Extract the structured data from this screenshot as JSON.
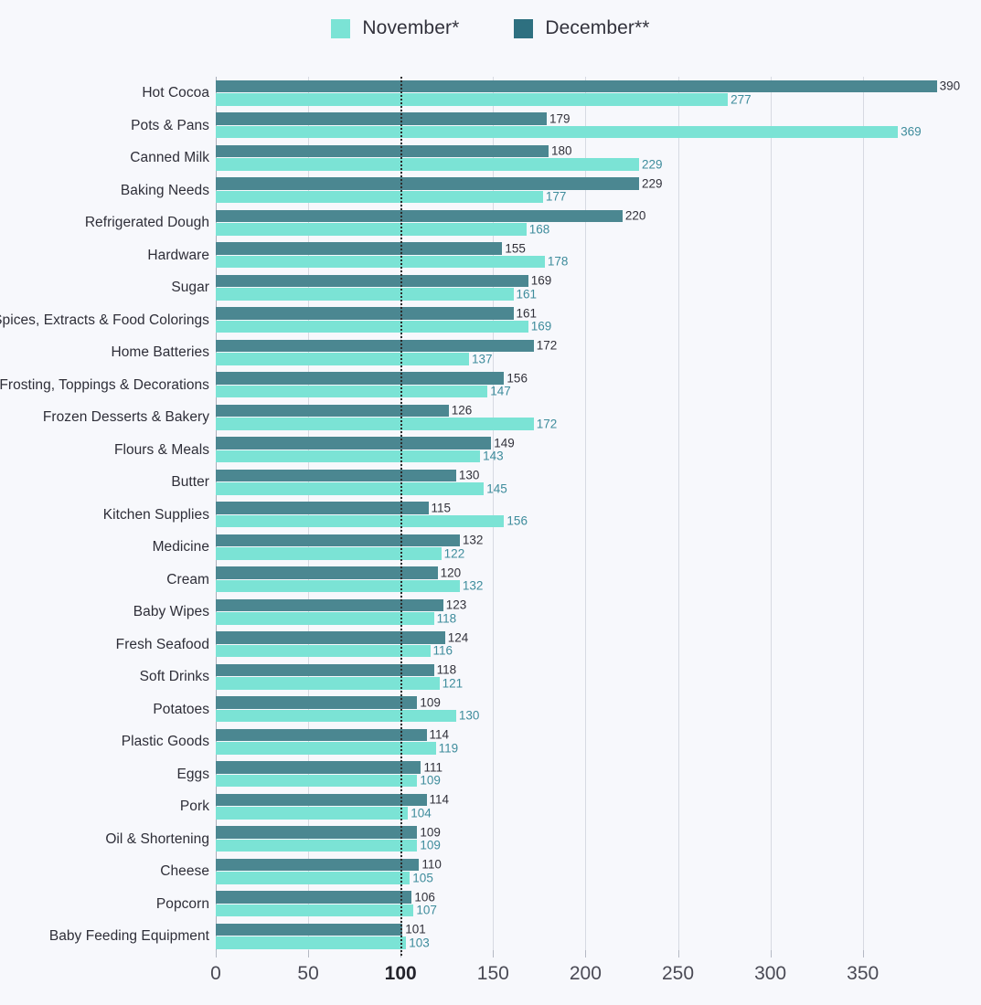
{
  "legend": {
    "items": [
      {
        "label": "November*",
        "color": "#7BE3D5",
        "key": "november"
      },
      {
        "label": "December**",
        "color": "#2E7080",
        "key": "december"
      }
    ]
  },
  "chart_data": {
    "type": "bar",
    "orientation": "horizontal",
    "title": "",
    "subtitle": "",
    "xlabel": "",
    "ylabel": "",
    "xlim": [
      0,
      393
    ],
    "xticks": [
      0,
      50,
      100,
      150,
      200,
      250,
      300,
      350
    ],
    "xtick_labels": [
      "0",
      "50",
      "100",
      "150",
      "200",
      "250",
      "300",
      "350"
    ],
    "emphasized_tick": "100",
    "grid": "vertical",
    "legend_position": "top-center",
    "reference_line": {
      "value": 100,
      "style": "dotted",
      "color": "#2b2b2b"
    },
    "categories": [
      "Hot Cocoa",
      "Pots & Pans",
      "Canned Milk",
      "Baking Needs",
      "Refrigerated Dough",
      "Hardware",
      "Sugar",
      "Spices, Extracts & Food Colorings",
      "Home Batteries",
      "Frosting, Toppings & Decorations",
      "Frozen Desserts & Bakery",
      "Flours & Meals",
      "Butter",
      "Kitchen Supplies",
      "Medicine",
      "Cream",
      "Baby Wipes",
      "Fresh Seafood",
      "Soft Drinks",
      "Potatoes",
      "Plastic Goods",
      "Eggs",
      "Pork",
      "Oil & Shortening",
      "Cheese",
      "Popcorn",
      "Baby Feeding Equipment"
    ],
    "series": [
      {
        "name": "December**",
        "key": "december",
        "color": "#4B8791",
        "values": [
          390,
          179,
          180,
          229,
          220,
          155,
          169,
          161,
          172,
          156,
          126,
          149,
          130,
          115,
          132,
          120,
          123,
          124,
          118,
          109,
          114,
          111,
          114,
          109,
          110,
          106,
          101
        ]
      },
      {
        "name": "November*",
        "key": "november",
        "color": "#7BE3D5",
        "values": [
          277,
          369,
          229,
          177,
          168,
          178,
          161,
          169,
          137,
          147,
          172,
          143,
          145,
          156,
          122,
          132,
          118,
          116,
          121,
          130,
          119,
          109,
          104,
          109,
          105,
          107,
          103
        ]
      }
    ]
  }
}
